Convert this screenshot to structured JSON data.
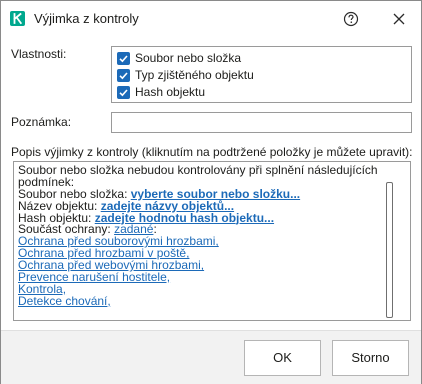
{
  "window": {
    "title": "Výjimka z kontroly",
    "logo_icon": "kaspersky-k-icon",
    "accent_color": "#00a88e",
    "help_icon": "question-circle-icon",
    "close_icon": "close-icon"
  },
  "properties": {
    "label": "Vlastnosti:",
    "options": [
      {
        "label": "Soubor nebo složka",
        "checked": true
      },
      {
        "label": "Typ zjištěného objektu",
        "checked": true
      },
      {
        "label": "Hash objektu",
        "checked": true
      }
    ]
  },
  "note": {
    "label": "Poznámka:",
    "value": "",
    "placeholder": ""
  },
  "description": {
    "label": "Popis výjimky z kontroly (kliknutím na podtržené položky je můžete upravit):",
    "line1": "Soubor nebo složka nebudou kontrolovány při splnění následujících",
    "line2": "podmínek:",
    "file_prefix": "Soubor nebo složka: ",
    "file_link": "vyberte soubor nebo složku...",
    "name_prefix": "Název objektu: ",
    "name_link": "zadejte názvy objektů...",
    "hash_prefix": "Hash objektu: ",
    "hash_link": "zadejte hodnotu hash objektu...",
    "component_prefix": "Součást ochrany: ",
    "component_link": "zadané",
    "component_suffix": ":",
    "components": [
      "Ochrana před souborovými hrozbami,",
      "Ochrana před hrozbami v poště,",
      "Ochrana před webovými hrozbami,",
      "Prevence narušení hostitele,",
      "Kontrola,",
      "Detekce chování,"
    ],
    "link_color": "#1c6ab8"
  },
  "buttons": {
    "ok_label": "OK",
    "cancel_label": "Storno"
  }
}
